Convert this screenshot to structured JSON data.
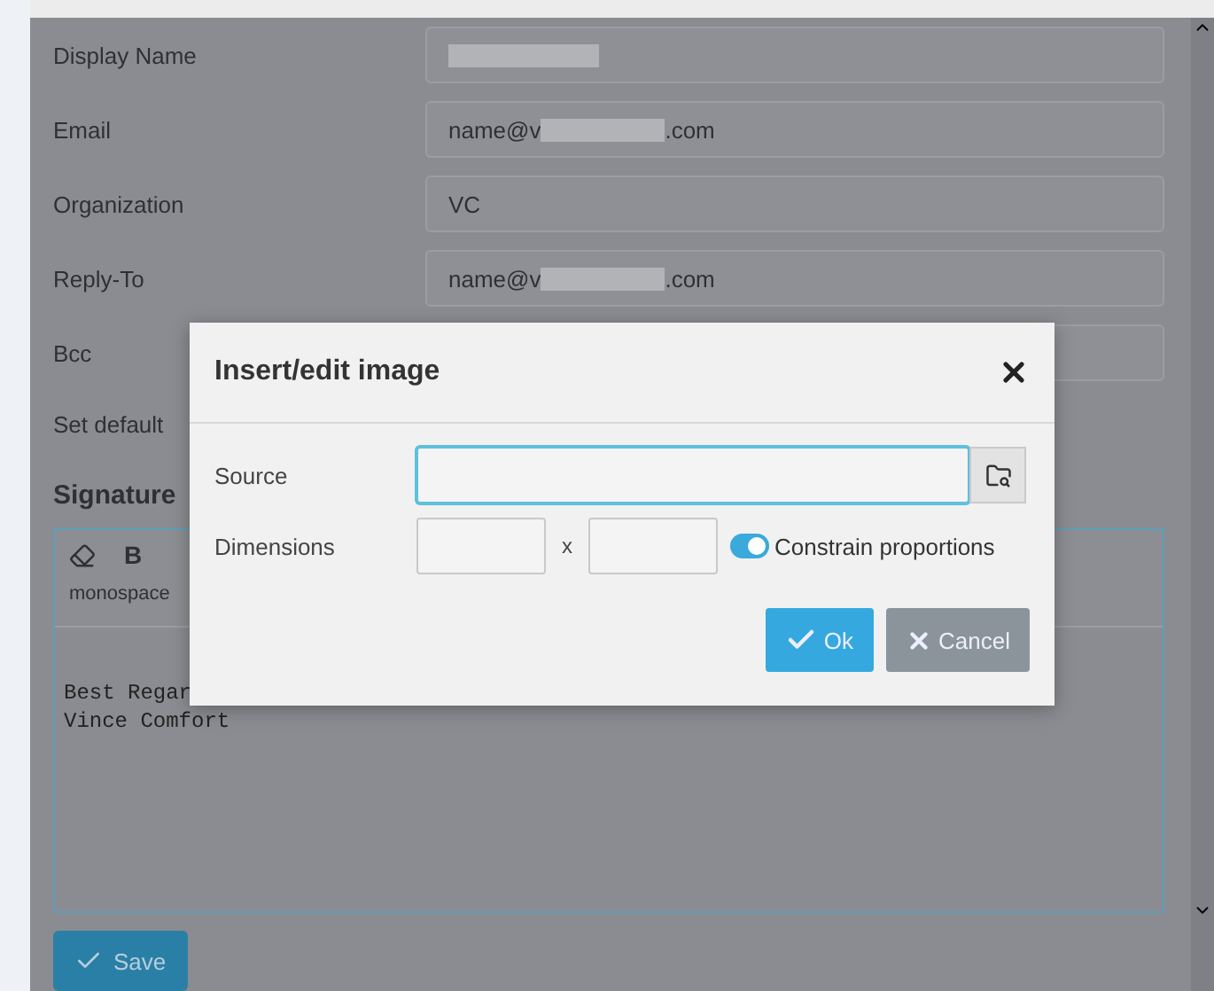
{
  "form": {
    "fields": [
      {
        "label": "Display Name",
        "kind": "redacted"
      },
      {
        "label": "Email",
        "kind": "masked",
        "prefix": "name@v",
        "suffix": ".com"
      },
      {
        "label": "Organization",
        "kind": "text",
        "value": "VC"
      },
      {
        "label": "Reply-To",
        "kind": "masked",
        "prefix": "name@v",
        "suffix": ".com"
      },
      {
        "label": "Bcc",
        "kind": "empty"
      }
    ],
    "set_default": {
      "label": "Set default"
    }
  },
  "signature": {
    "heading": "Signature",
    "toolbar": {
      "bold": "B",
      "font": "monospace"
    },
    "lines": [
      "Best Regar",
      "Vince Comfort"
    ]
  },
  "save_button": {
    "label": "Save"
  },
  "dialog": {
    "title": "Insert/edit image",
    "source": {
      "label": "Source",
      "focused": true
    },
    "dimensions": {
      "label": "Dimensions",
      "separator": "x"
    },
    "constrain": {
      "label": "Constrain proportions",
      "on": true
    },
    "buttons": [
      {
        "label": "Ok",
        "kind": "primary"
      },
      {
        "label": "Cancel",
        "kind": "secondary"
      }
    ]
  }
}
